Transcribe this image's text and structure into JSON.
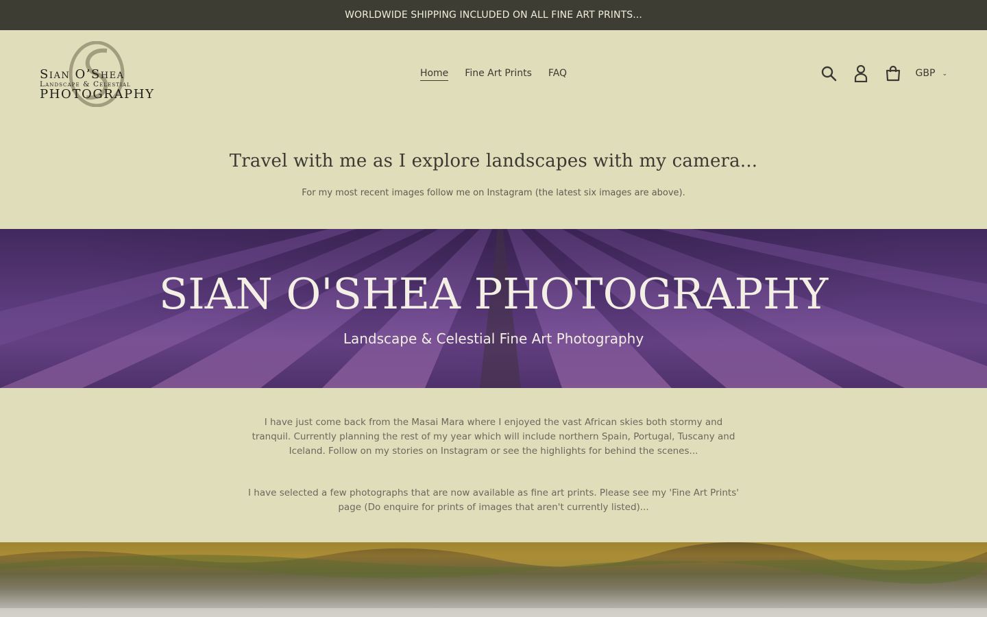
{
  "announcement": {
    "text": "WORLDWIDE SHIPPING INCLUDED ON ALL FINE ART PRINTS..."
  },
  "logo": {
    "line1": "Sian O’Shea",
    "line2": "Landscape & Celestial",
    "line3": "PHOTOGRAPHY"
  },
  "nav": {
    "items": [
      {
        "label": "Home"
      },
      {
        "label": "Fine Art Prints"
      },
      {
        "label": "FAQ"
      }
    ]
  },
  "header_icons": {
    "search": "search-icon",
    "account": "account-icon",
    "cart": "cart-icon"
  },
  "currency": {
    "selected": "GBP"
  },
  "intro": {
    "title": "Travel with me as I explore landscapes with my camera...",
    "subtitle": "For my most recent images follow me on Instagram (the latest six images are above)."
  },
  "hero": {
    "title": "SIAN O'SHEA PHOTOGRAPHY",
    "subtitle": "Landscape & Celestial Fine Art Photography"
  },
  "body": {
    "paragraph1": "I have just come back from the Masai Mara where I enjoyed the vast African skies both stormy and tranquil. Currently planning the rest of my year which will include northern Spain, Portugal, Tuscany and Iceland. Follow on my stories on Instagram or see the highlights for behind the scenes...",
    "paragraph2": "I have selected a few photographs that are now available as fine art prints. Please see my 'Fine Art Prints' page (Do enquire for prints of images that aren't currently listed)..."
  },
  "colors": {
    "background": "#e0ddbb",
    "announcement_bg": "#3e3d33",
    "text": "#3a3a33",
    "lavender": "#7a4f9e"
  }
}
